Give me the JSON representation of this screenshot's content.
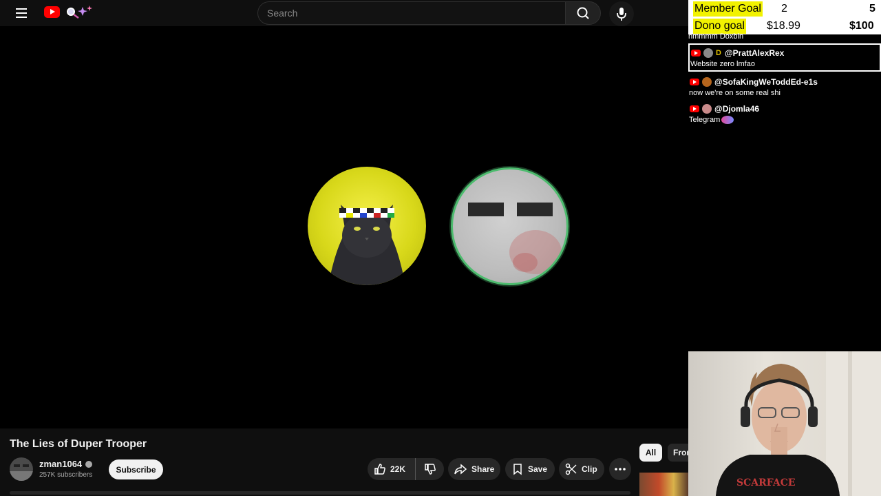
{
  "search": {
    "placeholder": "Search"
  },
  "video": {
    "title": "The Lies of Duper Trooper",
    "channel_name": "zman1064",
    "subscribers": "257K subscribers",
    "subscribe_label": "Subscribe",
    "likes": "22K",
    "share_label": "Share",
    "save_label": "Save",
    "clip_label": "Clip"
  },
  "chips": {
    "all": "All",
    "from": "From"
  },
  "goals": {
    "member_label": "Member Goal",
    "member_current": "2",
    "member_target": "5",
    "dono_label": "Dono goal",
    "dono_current": "$18.99",
    "dono_target": "$100"
  },
  "chat": {
    "cut_text": "hmmmm Doxbin",
    "messages": [
      {
        "author": "@PrattAlexRex",
        "badge": "D",
        "text": "Website zero lmfao",
        "avatar_color": "#8a8a8a"
      },
      {
        "author": "@SofaKingWeToddEd-e1s",
        "text": "now we're on some real shi",
        "avatar_color": "#b5651d"
      },
      {
        "author": "@Djomla46",
        "text": "Telegram",
        "avatar_color": "#c98a8a"
      }
    ]
  },
  "colors": {
    "brand_red": "#ff0000",
    "goal_highlight": "#f2f200",
    "ring_green": "#4dbb6e"
  }
}
